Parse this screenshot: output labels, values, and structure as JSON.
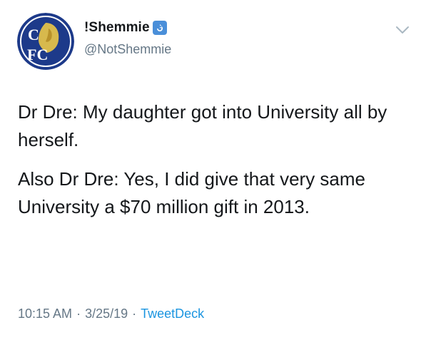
{
  "author": {
    "display_name": "!Shemmie",
    "handle": "@NotShemmie",
    "avatar_icon": "cfc-crest-avatar",
    "badge_icon": "return-arrow-icon",
    "avatar_text_top": "C",
    "avatar_text_bottom": "FC"
  },
  "menu": {
    "icon": "chevron-down-icon"
  },
  "tweet": {
    "paragraphs": [
      "Dr Dre: My daughter got into University all by herself.",
      "Also Dr Dre: Yes, I did give that very same University a $70 million gift in 2013."
    ]
  },
  "meta": {
    "time": "10:15 AM",
    "separator": "·",
    "date": "3/25/19",
    "source": "TweetDeck"
  },
  "colors": {
    "text": "#14171a",
    "secondary": "#657786",
    "link": "#1b95e0",
    "crest_blue": "#1d3a8a",
    "crest_gold": "#e2c04a"
  }
}
